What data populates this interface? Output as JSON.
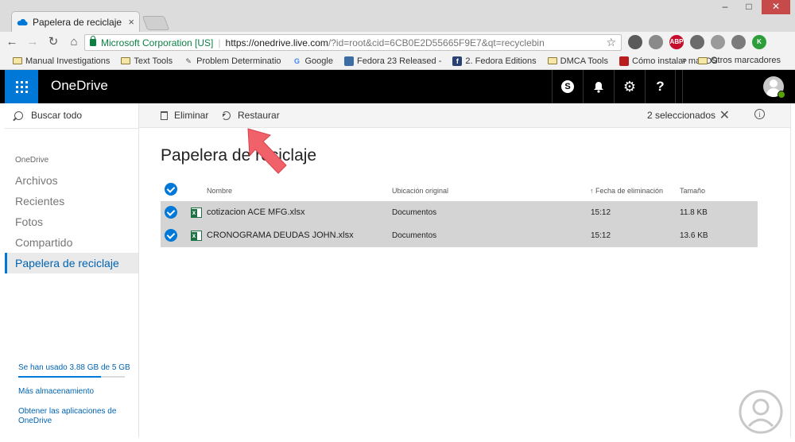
{
  "browser": {
    "tab_title": "Papelera de reciclaje - O",
    "tab_close": "×",
    "window_minimize": "–",
    "window_maximize": "□",
    "window_close": "✕",
    "nav_back": "←",
    "nav_forward": "→",
    "nav_reload": "↻",
    "nav_home": "⌂",
    "security_label": "Microsoft Corporation [US]",
    "url_host": "https://onedrive.live.com",
    "url_rest": "/?id=root&cid=6CB0E2D55665F9E7&qt=recyclebin",
    "star": "☆",
    "extensions": [
      {
        "label": "",
        "color": "#5a5a5a"
      },
      {
        "label": "",
        "color": "#8a8a8a"
      },
      {
        "label": "ABP",
        "color": "#c70d2c"
      },
      {
        "label": "",
        "color": "#6b6b6b"
      },
      {
        "label": "",
        "color": "#9a9a9a"
      },
      {
        "label": "",
        "color": "#7a7a7a"
      },
      {
        "label": "K",
        "color": "#2e9e3b"
      }
    ],
    "bookmarks": [
      {
        "label": "Manual Investigations",
        "type": "folder"
      },
      {
        "label": "Text Tools",
        "type": "folder"
      },
      {
        "label": "Problem Determinatio",
        "type": "tool"
      },
      {
        "label": "Google",
        "type": "google"
      },
      {
        "label": "Fedora 23 Released -",
        "type": "page"
      },
      {
        "label": "2. Fedora Editions",
        "type": "fedora"
      },
      {
        "label": "DMCA Tools",
        "type": "folder"
      },
      {
        "label": "Cómo instalar macOS",
        "type": "bookmark"
      }
    ],
    "bookmarks_more": "»",
    "other_bookmarks": "Otros marcadores"
  },
  "header": {
    "brand": "OneDrive",
    "skype_icon": "S",
    "bell_icon": "🔔",
    "settings_icon": "⚙",
    "help_icon": "?"
  },
  "nav": {
    "search_placeholder": "Buscar todo",
    "section_label": "OneDrive",
    "items": [
      "Archivos",
      "Recientes",
      "Fotos",
      "Compartido",
      "Papelera de reciclaje"
    ],
    "quota_text": "Se han usado 3.88 GB de 5 GB",
    "quota_fraction": 0.776,
    "more_storage": "Más almacenamiento",
    "get_apps": "Obtener las aplicaciones de OneDrive"
  },
  "commands": {
    "delete_label": "Eliminar",
    "restore_label": "Restaurar",
    "selected_count": "2 seleccionados",
    "clear_selection": "✕",
    "info": "i"
  },
  "main": {
    "title": "Papelera de reciclaje",
    "columns": {
      "name": "Nombre",
      "location": "Ubicación original",
      "date": "↑ Fecha de eliminación",
      "size": "Tamaño"
    },
    "rows": [
      {
        "name": "cotizacion ACE MFG.xlsx",
        "location": "Documentos",
        "time": "15:12",
        "size": "11.8 KB"
      },
      {
        "name": "CRONOGRAMA DEUDAS JOHN.xlsx",
        "location": "Documentos",
        "time": "15:12",
        "size": "13.6 KB"
      }
    ]
  },
  "colors": {
    "accent": "#0078d7",
    "link": "#0063b1",
    "annotation_arrow": "#f0616a",
    "excel_green": "#1e7145",
    "secure_green": "#0b8043"
  }
}
